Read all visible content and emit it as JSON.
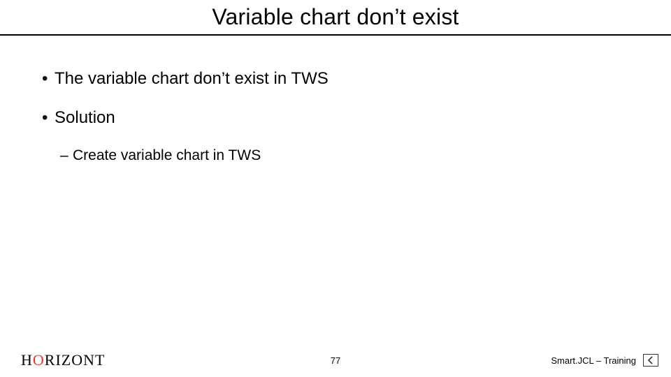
{
  "title": "Variable chart don’t exist",
  "bullets": [
    {
      "text": "The variable chart don’t exist in TWS"
    },
    {
      "text": "Solution",
      "children": [
        {
          "text": "Create variable chart in TWS"
        }
      ]
    }
  ],
  "footer": {
    "brand_left": "H",
    "brand_o": "O",
    "brand_rest": "RIZONT",
    "page": "77",
    "right_label": "Smart.JCL – Training"
  }
}
